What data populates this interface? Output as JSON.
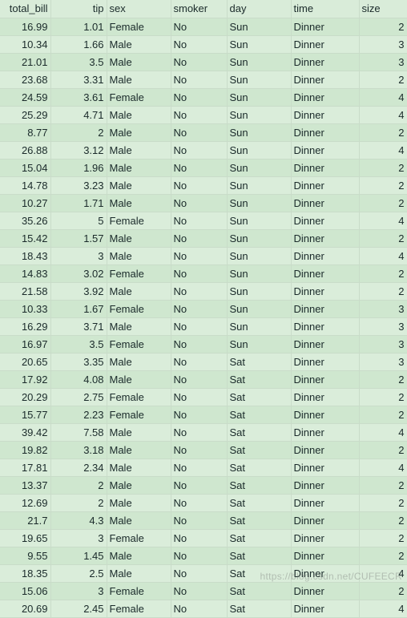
{
  "columns": [
    "total_bill",
    "tip",
    "sex",
    "smoker",
    "day",
    "time",
    "size"
  ],
  "rows": [
    {
      "total_bill": "16.99",
      "tip": "1.01",
      "sex": "Female",
      "smoker": "No",
      "day": "Sun",
      "time": "Dinner",
      "size": "2"
    },
    {
      "total_bill": "10.34",
      "tip": "1.66",
      "sex": "Male",
      "smoker": "No",
      "day": "Sun",
      "time": "Dinner",
      "size": "3"
    },
    {
      "total_bill": "21.01",
      "tip": "3.5",
      "sex": "Male",
      "smoker": "No",
      "day": "Sun",
      "time": "Dinner",
      "size": "3"
    },
    {
      "total_bill": "23.68",
      "tip": "3.31",
      "sex": "Male",
      "smoker": "No",
      "day": "Sun",
      "time": "Dinner",
      "size": "2"
    },
    {
      "total_bill": "24.59",
      "tip": "3.61",
      "sex": "Female",
      "smoker": "No",
      "day": "Sun",
      "time": "Dinner",
      "size": "4"
    },
    {
      "total_bill": "25.29",
      "tip": "4.71",
      "sex": "Male",
      "smoker": "No",
      "day": "Sun",
      "time": "Dinner",
      "size": "4"
    },
    {
      "total_bill": "8.77",
      "tip": "2",
      "sex": "Male",
      "smoker": "No",
      "day": "Sun",
      "time": "Dinner",
      "size": "2"
    },
    {
      "total_bill": "26.88",
      "tip": "3.12",
      "sex": "Male",
      "smoker": "No",
      "day": "Sun",
      "time": "Dinner",
      "size": "4"
    },
    {
      "total_bill": "15.04",
      "tip": "1.96",
      "sex": "Male",
      "smoker": "No",
      "day": "Sun",
      "time": "Dinner",
      "size": "2"
    },
    {
      "total_bill": "14.78",
      "tip": "3.23",
      "sex": "Male",
      "smoker": "No",
      "day": "Sun",
      "time": "Dinner",
      "size": "2"
    },
    {
      "total_bill": "10.27",
      "tip": "1.71",
      "sex": "Male",
      "smoker": "No",
      "day": "Sun",
      "time": "Dinner",
      "size": "2"
    },
    {
      "total_bill": "35.26",
      "tip": "5",
      "sex": "Female",
      "smoker": "No",
      "day": "Sun",
      "time": "Dinner",
      "size": "4"
    },
    {
      "total_bill": "15.42",
      "tip": "1.57",
      "sex": "Male",
      "smoker": "No",
      "day": "Sun",
      "time": "Dinner",
      "size": "2"
    },
    {
      "total_bill": "18.43",
      "tip": "3",
      "sex": "Male",
      "smoker": "No",
      "day": "Sun",
      "time": "Dinner",
      "size": "4"
    },
    {
      "total_bill": "14.83",
      "tip": "3.02",
      "sex": "Female",
      "smoker": "No",
      "day": "Sun",
      "time": "Dinner",
      "size": "2"
    },
    {
      "total_bill": "21.58",
      "tip": "3.92",
      "sex": "Male",
      "smoker": "No",
      "day": "Sun",
      "time": "Dinner",
      "size": "2"
    },
    {
      "total_bill": "10.33",
      "tip": "1.67",
      "sex": "Female",
      "smoker": "No",
      "day": "Sun",
      "time": "Dinner",
      "size": "3"
    },
    {
      "total_bill": "16.29",
      "tip": "3.71",
      "sex": "Male",
      "smoker": "No",
      "day": "Sun",
      "time": "Dinner",
      "size": "3"
    },
    {
      "total_bill": "16.97",
      "tip": "3.5",
      "sex": "Female",
      "smoker": "No",
      "day": "Sun",
      "time": "Dinner",
      "size": "3"
    },
    {
      "total_bill": "20.65",
      "tip": "3.35",
      "sex": "Male",
      "smoker": "No",
      "day": "Sat",
      "time": "Dinner",
      "size": "3"
    },
    {
      "total_bill": "17.92",
      "tip": "4.08",
      "sex": "Male",
      "smoker": "No",
      "day": "Sat",
      "time": "Dinner",
      "size": "2"
    },
    {
      "total_bill": "20.29",
      "tip": "2.75",
      "sex": "Female",
      "smoker": "No",
      "day": "Sat",
      "time": "Dinner",
      "size": "2"
    },
    {
      "total_bill": "15.77",
      "tip": "2.23",
      "sex": "Female",
      "smoker": "No",
      "day": "Sat",
      "time": "Dinner",
      "size": "2"
    },
    {
      "total_bill": "39.42",
      "tip": "7.58",
      "sex": "Male",
      "smoker": "No",
      "day": "Sat",
      "time": "Dinner",
      "size": "4"
    },
    {
      "total_bill": "19.82",
      "tip": "3.18",
      "sex": "Male",
      "smoker": "No",
      "day": "Sat",
      "time": "Dinner",
      "size": "2"
    },
    {
      "total_bill": "17.81",
      "tip": "2.34",
      "sex": "Male",
      "smoker": "No",
      "day": "Sat",
      "time": "Dinner",
      "size": "4"
    },
    {
      "total_bill": "13.37",
      "tip": "2",
      "sex": "Male",
      "smoker": "No",
      "day": "Sat",
      "time": "Dinner",
      "size": "2"
    },
    {
      "total_bill": "12.69",
      "tip": "2",
      "sex": "Male",
      "smoker": "No",
      "day": "Sat",
      "time": "Dinner",
      "size": "2"
    },
    {
      "total_bill": "21.7",
      "tip": "4.3",
      "sex": "Male",
      "smoker": "No",
      "day": "Sat",
      "time": "Dinner",
      "size": "2"
    },
    {
      "total_bill": "19.65",
      "tip": "3",
      "sex": "Female",
      "smoker": "No",
      "day": "Sat",
      "time": "Dinner",
      "size": "2"
    },
    {
      "total_bill": "9.55",
      "tip": "1.45",
      "sex": "Male",
      "smoker": "No",
      "day": "Sat",
      "time": "Dinner",
      "size": "2"
    },
    {
      "total_bill": "18.35",
      "tip": "2.5",
      "sex": "Male",
      "smoker": "No",
      "day": "Sat",
      "time": "Dinner",
      "size": "4"
    },
    {
      "total_bill": "15.06",
      "tip": "3",
      "sex": "Female",
      "smoker": "No",
      "day": "Sat",
      "time": "Dinner",
      "size": "2"
    },
    {
      "total_bill": "20.69",
      "tip": "2.45",
      "sex": "Female",
      "smoker": "No",
      "day": "Sat",
      "time": "Dinner",
      "size": "4"
    }
  ],
  "watermark": "https://blog.csdn.net/CUFEECR"
}
